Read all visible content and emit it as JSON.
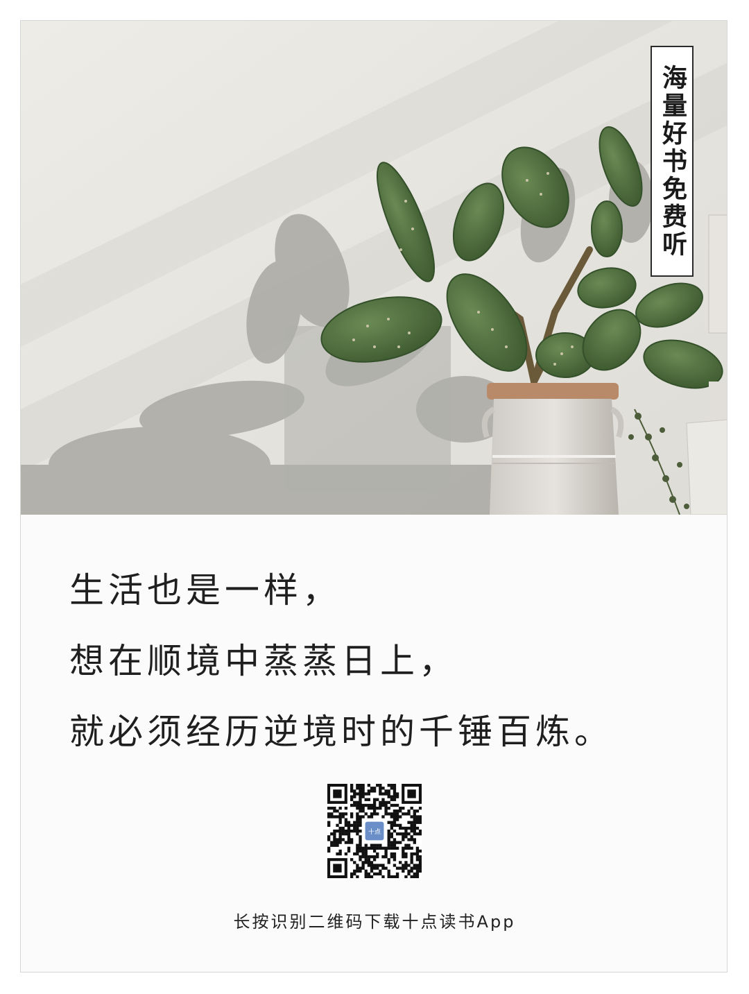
{
  "tag": {
    "text": "海量好书免费听"
  },
  "quote": {
    "lines": [
      "生活也是一样，",
      "想在顺境中蒸蒸日上，",
      "就必须经历逆境时的千锤百炼。"
    ]
  },
  "qr": {
    "center_label": "十点"
  },
  "caption": {
    "text": "长按识别二维码下载十点读书App"
  },
  "colors": {
    "wall": "#e9e7e1",
    "shadow": "#a7a6a0",
    "cactus": "#4f6d3e",
    "pot": "#dcd8d2",
    "text": "#1f1f1f"
  }
}
